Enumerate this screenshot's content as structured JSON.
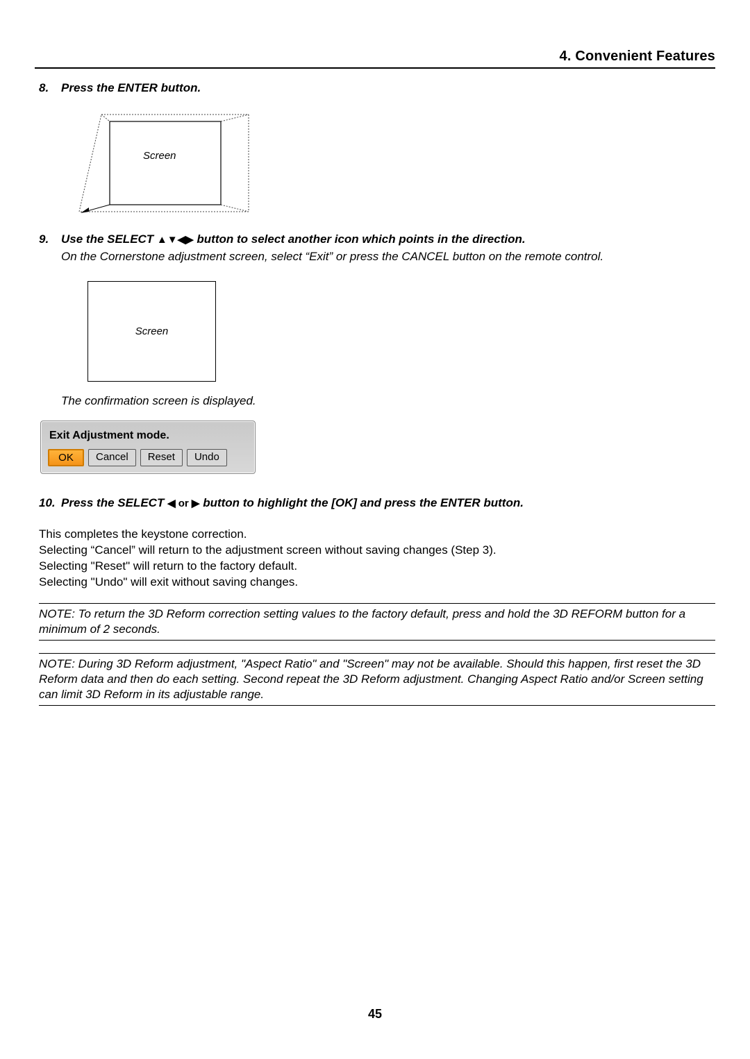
{
  "header": "4. Convenient Features",
  "steps": {
    "s8": {
      "num": "8.",
      "text": "Press the ENTER button."
    },
    "s9": {
      "num": "9.",
      "text_before": "Use the SELECT ",
      "text_after": " button to select another icon which points in the direction.",
      "sub": "On the Cornerstone adjustment screen, select “Exit” or press the CANCEL button on the remote control."
    },
    "s10": {
      "num": "10.",
      "text_before": "Press the SELECT ",
      "text_after": " button to highlight the [OK] and press the ENTER button."
    }
  },
  "arrows4": "▲▼◀▶",
  "arrows2": "◀ or ▶",
  "screen_label": "Screen",
  "confirm_text": "The confirmation screen is displayed.",
  "dialog": {
    "title": "Exit Adjustment mode.",
    "ok": "OK",
    "cancel": "Cancel",
    "reset": "Reset",
    "undo": "Undo"
  },
  "body": {
    "l1": "This completes the keystone correction.",
    "l2": "Selecting “Cancel” will return to the adjustment screen without saving changes (Step 3).",
    "l3": "Selecting \"Reset\" will return to the factory default.",
    "l4": "Selecting \"Undo\" will exit without saving changes."
  },
  "note1": "NOTE: To return the 3D Reform correction setting values to the factory default, press and hold the 3D REFORM button for a minimum of 2 seconds.",
  "note2": "NOTE: During 3D Reform adjustment, \"Aspect Ratio\" and \"Screen\" may not be available. Should this happen, first reset the 3D Reform data and then do each setting. Second repeat the 3D Reform adjustment. Changing Aspect Ratio and/or Screen setting can limit 3D Reform in its adjustable range.",
  "page_number": "45"
}
